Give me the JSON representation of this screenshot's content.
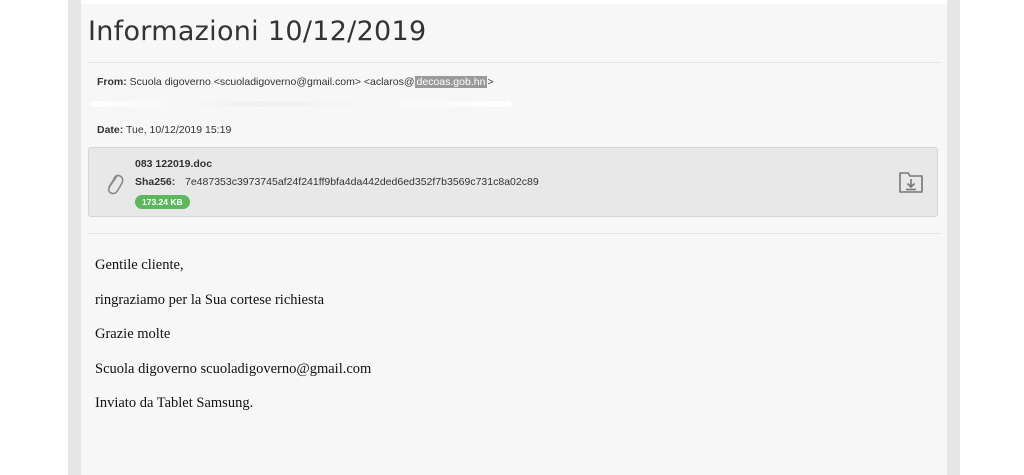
{
  "email": {
    "title": "Informazioni 10/12/2019",
    "from_label": "From:",
    "from_value": "Scuola digoverno <scuoladigoverno@gmail.com> <aclaros@",
    "from_highlight": "decoas.gob.hn",
    "from_suffix": ">",
    "date_label": "Date:",
    "date_value": "Tue, 10/12/2019 15:19"
  },
  "attachment": {
    "name": "083 122019.doc",
    "sha_label": "Sha256:",
    "sha_value": "7e487353c3973745af24f241ff9bfa4da442ded6ed352f7b3569c731c8a02c89",
    "size": "173.24 KB",
    "clip_icon": "paperclip-icon",
    "download_icon": "download-icon"
  },
  "body": {
    "lines": [
      "Gentile cliente,",
      "ringraziamo per la Sua cortese richiesta",
      "Grazie molte",
      "Scuola digoverno scuoladigoverno@gmail.com",
      "Inviato da Tablet Samsung."
    ]
  },
  "colors": {
    "size_badge": "#5cb85c",
    "highlight": "#9a9a9a",
    "attachment_bg": "#e8e8e8"
  }
}
